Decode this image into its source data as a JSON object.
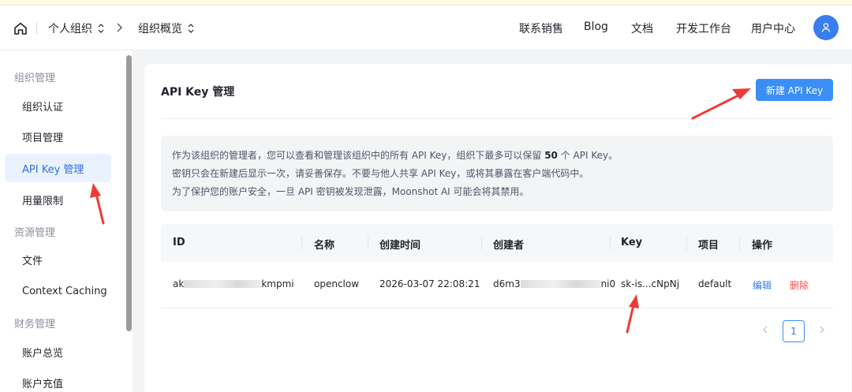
{
  "header": {
    "org": "个人组织",
    "page": "组织概览",
    "nav": [
      "联系销售",
      "Blog",
      "文档",
      "开发工作台",
      "用户中心"
    ]
  },
  "sidebar": {
    "groups": [
      "组织管理",
      "资源管理",
      "财务管理"
    ],
    "items": [
      "组织认证",
      "项目管理",
      "API Key 管理",
      "用量限制",
      "文件",
      "Context Caching",
      "账户总览",
      "账户充值"
    ],
    "active_item": "API Key 管理"
  },
  "card": {
    "title": "API Key 管理",
    "new_button": "新建 API Key",
    "notice": {
      "line1_before": "作为该组织的管理者，您可以查看和管理该组织中的所有 API Key，组织下最多可以保留",
      "line1_count": "50",
      "line1_after": "个 API Key。",
      "line2": "密钥只会在新建后显示一次，请妥善保存。不要与他人共享 API Key，或将其暴露在客户端代码中。",
      "line3": "为了保护您的账户安全，一旦 API 密钥被发现泄露，Moonshot AI 可能会将其禁用。"
    },
    "table": {
      "columns": [
        "ID",
        "名称",
        "创建时间",
        "创建者",
        "Key",
        "项目",
        "操作"
      ],
      "rows": [
        {
          "id_prefix": "ak",
          "id_suffix": "kmpmi",
          "name": "openclow",
          "created": "2026-03-07 22:08:21",
          "creator_prefix": "d6m3",
          "creator_suffix": "ni0",
          "key": "sk-is...cNpNj",
          "project": "default",
          "edit": "编辑",
          "delete": "删除"
        }
      ]
    },
    "pagination": {
      "current": "1"
    }
  },
  "colors": {
    "accent": "#3a8ef6",
    "annotation": "#ee3b36",
    "delete": "#f0504b"
  },
  "icons": [
    "home-icon",
    "chevron-updown-icon",
    "chevron-right-icon",
    "user-icon",
    "chevron-left-icon"
  ]
}
